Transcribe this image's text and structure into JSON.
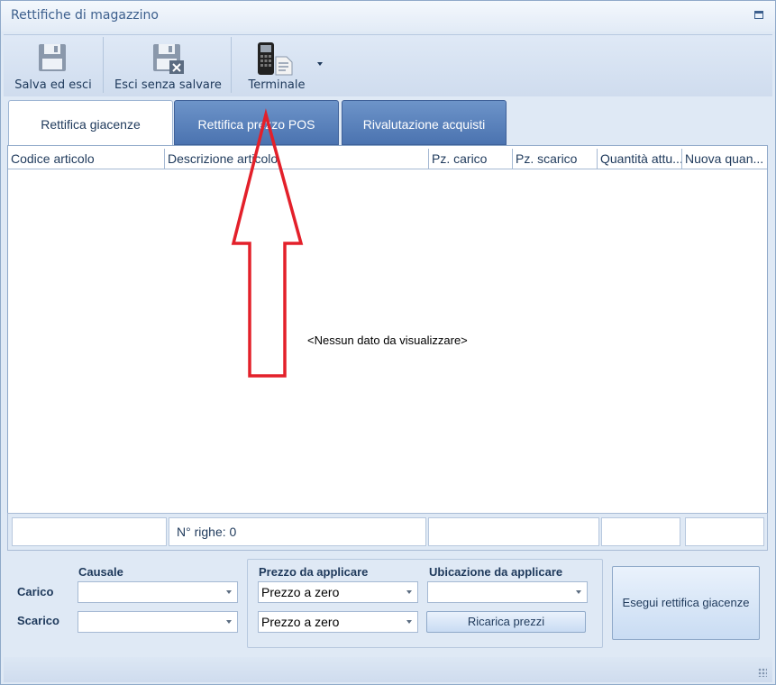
{
  "window": {
    "title": "Rettifiche di magazzino"
  },
  "toolbar": {
    "save_exit": "Salva ed esci",
    "exit_nosave": "Esci senza salvare",
    "terminal": "Terminale"
  },
  "tabs": [
    {
      "label": "Rettifica giacenze",
      "active": true
    },
    {
      "label": "Rettifica prezzo POS",
      "active": false
    },
    {
      "label": "Rivalutazione acquisti",
      "active": false
    }
  ],
  "grid": {
    "columns": [
      "Codice articolo",
      "Descrizione articolo",
      "Pz. carico",
      "Pz. scarico",
      "Quantità attu...",
      "Nuova quan..."
    ],
    "empty_text": "<Nessun dato da visualizzare>"
  },
  "footer": {
    "row_count": "N° righe: 0"
  },
  "form": {
    "causale_label": "Causale",
    "carico_label": "Carico",
    "scarico_label": "Scarico",
    "carico_causale": "",
    "scarico_causale": "",
    "prezzo_label": "Prezzo da applicare",
    "prezzo_carico": "Prezzo a zero",
    "prezzo_scarico": "Prezzo a zero",
    "ubicazione_label": "Ubicazione da applicare",
    "ubicazione_value": "",
    "reload_prices": "Ricarica prezzi",
    "execute": "Esegui rettifica giacenze"
  },
  "colors": {
    "annotation_arrow": "#e3202a",
    "active_tab": "#ffffff",
    "inactive_tab": "#5a82bd"
  }
}
